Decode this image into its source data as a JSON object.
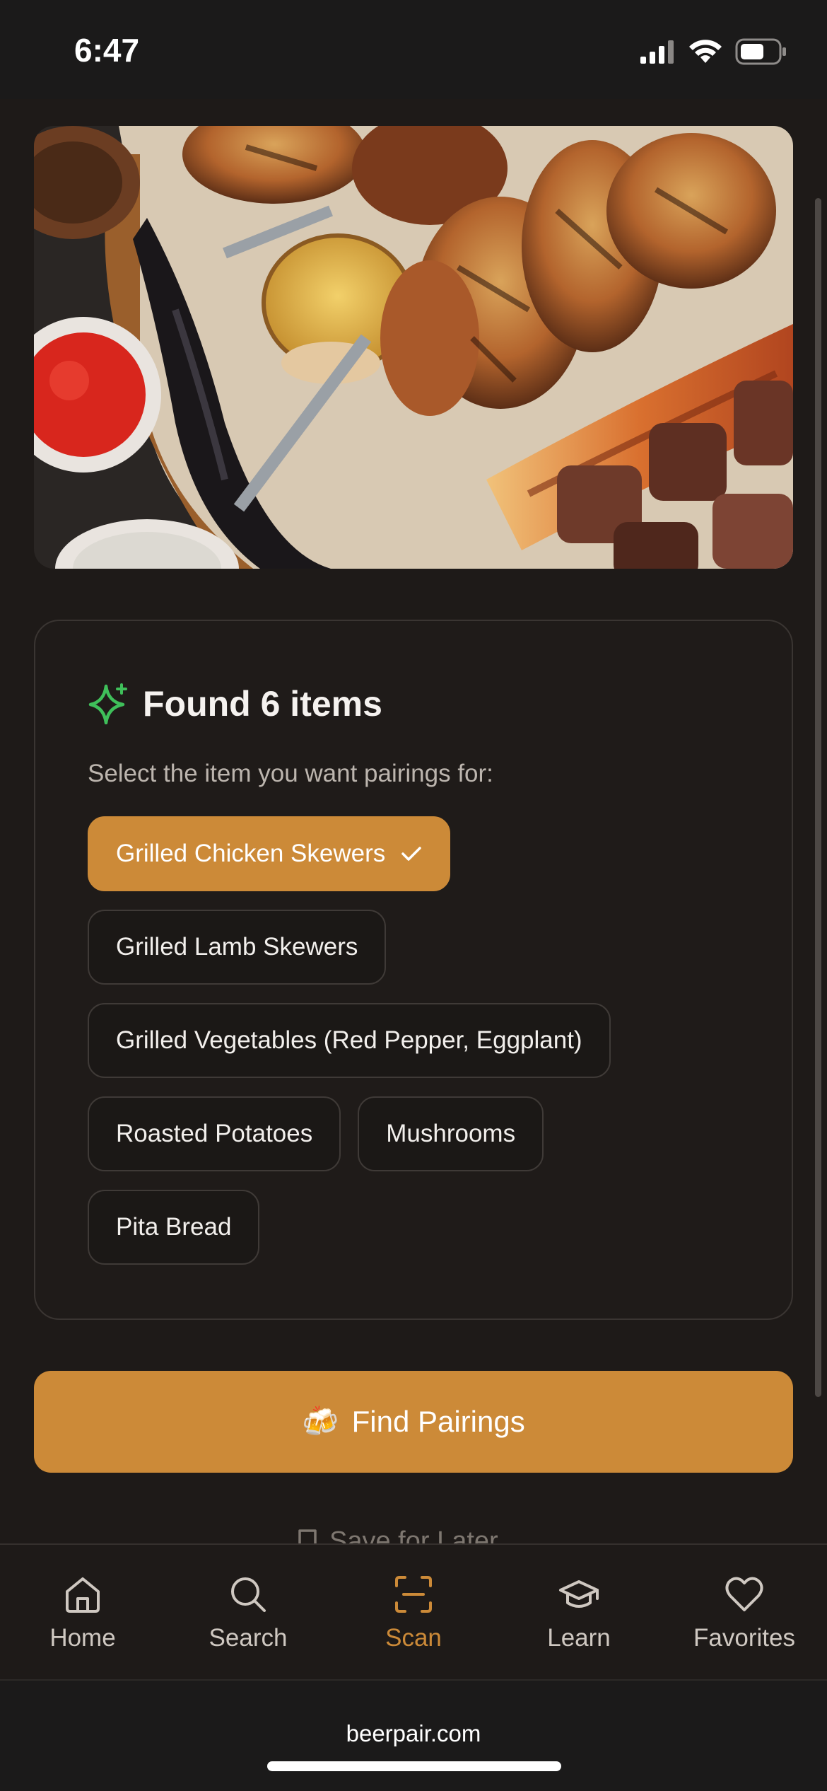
{
  "status": {
    "time": "6:47"
  },
  "card": {
    "title": "Found 6 items",
    "subtitle": "Select the item you want pairings for:",
    "items": [
      {
        "label": "Grilled Chicken Skewers",
        "selected": true
      },
      {
        "label": "Grilled Lamb Skewers",
        "selected": false
      },
      {
        "label": "Grilled Vegetables (Red Pepper, Eggplant)",
        "selected": false
      },
      {
        "label": "Roasted Potatoes",
        "selected": false
      },
      {
        "label": "Mushrooms",
        "selected": false
      },
      {
        "label": "Pita Bread",
        "selected": false
      }
    ]
  },
  "actions": {
    "find_pairings": "Find Pairings",
    "find_icon": "🍻",
    "save_later": "Save for Later"
  },
  "tabs": [
    {
      "label": "Home",
      "icon": "home-icon"
    },
    {
      "label": "Search",
      "icon": "search-icon"
    },
    {
      "label": "Scan",
      "icon": "scan-icon",
      "active": true
    },
    {
      "label": "Learn",
      "icon": "graduation-cap-icon"
    },
    {
      "label": "Favorites",
      "icon": "heart-icon"
    }
  ],
  "browser": {
    "url": "beerpair.com"
  },
  "colors": {
    "accent": "#cc8a38",
    "sparkle": "#3fbf5a",
    "background": "#1e1a18"
  }
}
